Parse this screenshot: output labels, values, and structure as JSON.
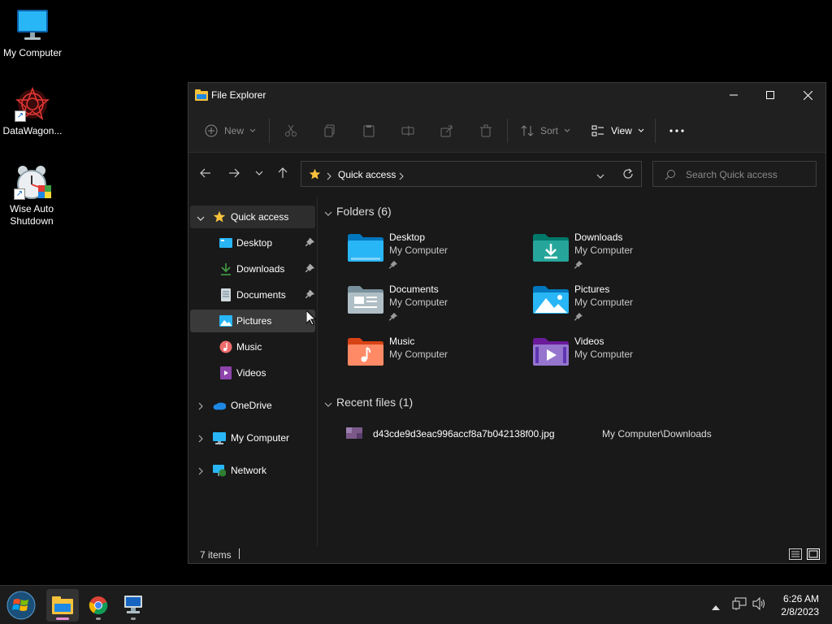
{
  "desktop": {
    "icons": [
      {
        "label": "My Computer"
      },
      {
        "label": "DataWagon..."
      },
      {
        "label": "Wise Auto Shutdown"
      }
    ]
  },
  "window": {
    "title": "File Explorer",
    "toolbar": {
      "new_label": "New",
      "sort_label": "Sort",
      "view_label": "View"
    },
    "address": {
      "crumb": "Quick access"
    },
    "search": {
      "placeholder": "Search Quick access"
    },
    "sidebar": {
      "items": [
        {
          "label": "Quick access"
        },
        {
          "label": "Desktop"
        },
        {
          "label": "Downloads"
        },
        {
          "label": "Documents"
        },
        {
          "label": "Pictures"
        },
        {
          "label": "Music"
        },
        {
          "label": "Videos"
        },
        {
          "label": "OneDrive"
        },
        {
          "label": "My Computer"
        },
        {
          "label": "Network"
        }
      ]
    },
    "folders_header": "Folders (6)",
    "folders": [
      {
        "name": "Desktop",
        "location": "My Computer"
      },
      {
        "name": "Downloads",
        "location": "My Computer"
      },
      {
        "name": "Documents",
        "location": "My Computer"
      },
      {
        "name": "Pictures",
        "location": "My Computer"
      },
      {
        "name": "Music",
        "location": "My Computer"
      },
      {
        "name": "Videos",
        "location": "My Computer"
      }
    ],
    "recent_header": "Recent files (1)",
    "recent": [
      {
        "name": "d43cde9d3eac996accf8a7b042138f00.jpg",
        "path": "My Computer\\Downloads"
      }
    ],
    "status": {
      "items": "7 items"
    }
  },
  "taskbar": {
    "time": "6:26 AM",
    "date": "2/8/2023"
  }
}
